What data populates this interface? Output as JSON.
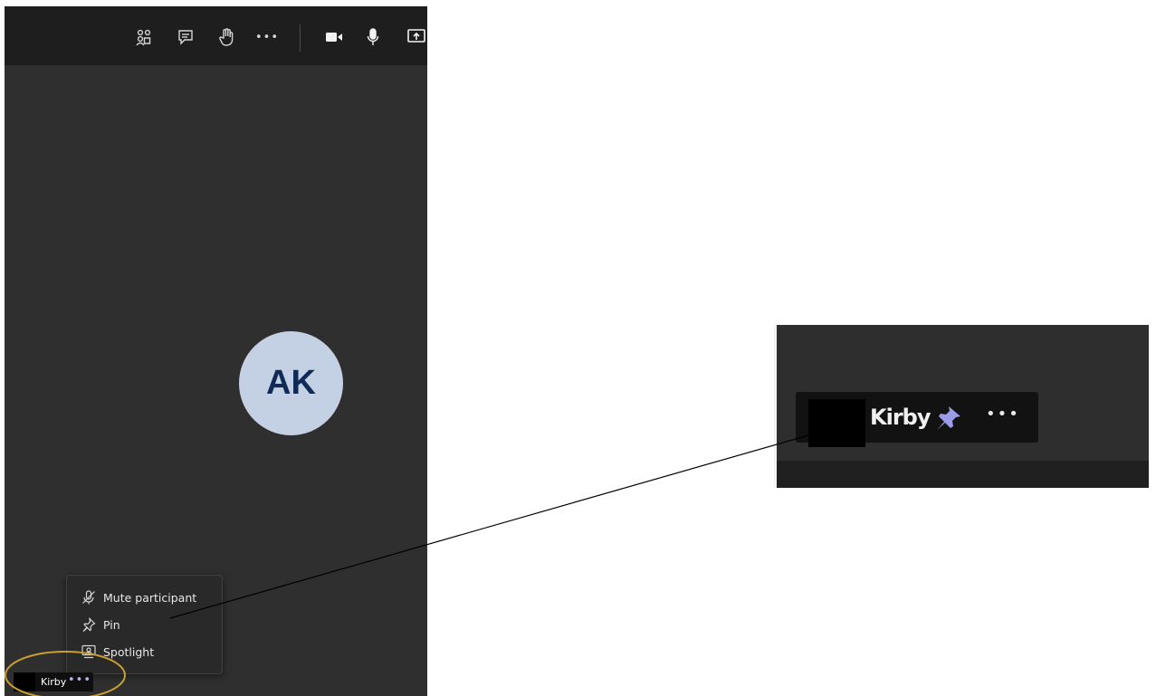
{
  "toolbar": {
    "icons": [
      "people-icon",
      "chat-icon",
      "raise-hand-icon",
      "more-options-icon",
      "camera-icon",
      "microphone-icon",
      "share-screen-icon"
    ],
    "more_label": "•••"
  },
  "participant": {
    "initials": "AK",
    "name": "Kirby",
    "more_label": "•••",
    "avatar_color": "#c4d0e4"
  },
  "context_menu": {
    "items": [
      {
        "label": "Mute participant",
        "icon": "mute-icon"
      },
      {
        "label": "Pin",
        "icon": "pin-icon"
      },
      {
        "label": "Spotlight",
        "icon": "spotlight-icon"
      }
    ]
  },
  "zoom_inset": {
    "name": "Kirby",
    "pin_icon": "pinned-icon",
    "more_label": "•••",
    "pin_color": "#9b9bea"
  },
  "colors": {
    "highlight_circle": "#c8a030",
    "meeting_background": "#2f2f2f",
    "toolbar_background": "#1e1e1e",
    "accent_purple": "#b8b3f0"
  }
}
